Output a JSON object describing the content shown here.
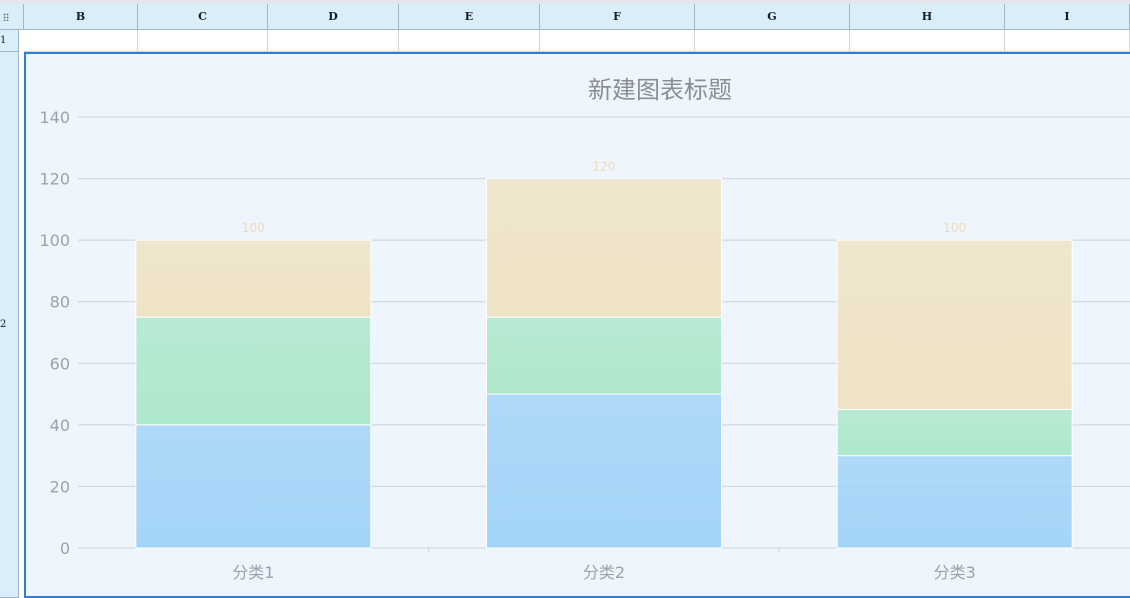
{
  "spreadsheet": {
    "columns": [
      "B",
      "C",
      "D",
      "E",
      "F",
      "G",
      "H",
      "I"
    ],
    "rows": [
      "1",
      "2"
    ]
  },
  "chart_data": {
    "type": "bar",
    "stacked": true,
    "title": "新建图表标题",
    "categories": [
      "分类1",
      "分类2",
      "分类3"
    ],
    "series": [
      {
        "values": [
          40,
          50,
          30
        ],
        "color": "#a3d4f7"
      },
      {
        "values": [
          35,
          25,
          15
        ],
        "color": "#aee8cc"
      },
      {
        "values": [
          25,
          45,
          55
        ],
        "color": "#efe3c5"
      }
    ],
    "totals": [
      "100",
      "120",
      "100"
    ],
    "y_ticks": [
      "0",
      "20",
      "40",
      "60",
      "80",
      "100",
      "120",
      "140"
    ],
    "ylim": [
      0,
      140
    ],
    "grid": true
  }
}
